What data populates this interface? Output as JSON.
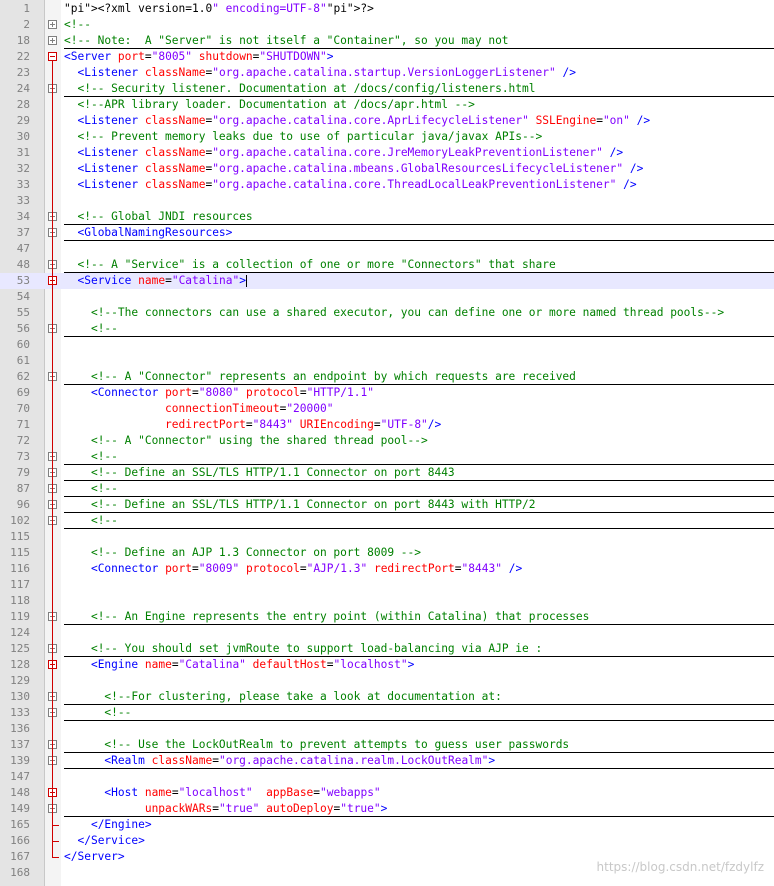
{
  "lines": [
    {
      "n": "1",
      "fold": "",
      "code": "<?xml version=\"1.0\" encoding=\"UTF-8\"?>",
      "under": false
    },
    {
      "n": "2",
      "fold": "closed",
      "code": "<!--",
      "under": false
    },
    {
      "n": "18",
      "fold": "closed",
      "code": "<!-- Note:  A \"Server\" is not itself a \"Container\", so you may not",
      "under": true
    },
    {
      "n": "22",
      "fold": "open",
      "code": "<Server port=\"8005\" shutdown=\"SHUTDOWN\">",
      "under": false
    },
    {
      "n": "23",
      "fold": "",
      "code": "  <Listener className=\"org.apache.catalina.startup.VersionLoggerListener\" />",
      "under": false
    },
    {
      "n": "24",
      "fold": "closed",
      "code": "  <!-- Security listener. Documentation at /docs/config/listeners.html",
      "under": true
    },
    {
      "n": "28",
      "fold": "",
      "code": "  <!--APR library loader. Documentation at /docs/apr.html -->",
      "under": false
    },
    {
      "n": "29",
      "fold": "",
      "code": "  <Listener className=\"org.apache.catalina.core.AprLifecycleListener\" SSLEngine=\"on\" />",
      "under": false
    },
    {
      "n": "30",
      "fold": "",
      "code": "  <!-- Prevent memory leaks due to use of particular java/javax APIs-->",
      "under": false
    },
    {
      "n": "31",
      "fold": "",
      "code": "  <Listener className=\"org.apache.catalina.core.JreMemoryLeakPreventionListener\" />",
      "under": false
    },
    {
      "n": "32",
      "fold": "",
      "code": "  <Listener className=\"org.apache.catalina.mbeans.GlobalResourcesLifecycleListener\" />",
      "under": false
    },
    {
      "n": "33",
      "fold": "",
      "code": "  <Listener className=\"org.apache.catalina.core.ThreadLocalLeakPreventionListener\" />",
      "under": false
    },
    {
      "n": "33",
      "fold": "",
      "code": "",
      "under": false
    },
    {
      "n": "34",
      "fold": "closed",
      "code": "  <!-- Global JNDI resources",
      "under": true
    },
    {
      "n": "37",
      "fold": "closed",
      "code": "  <GlobalNamingResources>",
      "under": true
    },
    {
      "n": "47",
      "fold": "",
      "code": "",
      "under": false
    },
    {
      "n": "48",
      "fold": "closed",
      "code": "  <!-- A \"Service\" is a collection of one or more \"Connectors\" that share",
      "under": true
    },
    {
      "n": "53",
      "fold": "open",
      "code": "  <Service name=\"Catalina\">",
      "under": false,
      "highlight": true
    },
    {
      "n": "54",
      "fold": "",
      "code": "",
      "under": false
    },
    {
      "n": "55",
      "fold": "",
      "code": "    <!--The connectors can use a shared executor, you can define one or more named thread pools-->",
      "under": false
    },
    {
      "n": "56",
      "fold": "closed",
      "code": "    <!--",
      "under": true
    },
    {
      "n": "60",
      "fold": "",
      "code": "",
      "under": false
    },
    {
      "n": "61",
      "fold": "",
      "code": "",
      "under": false
    },
    {
      "n": "62",
      "fold": "closed",
      "code": "    <!-- A \"Connector\" represents an endpoint by which requests are received",
      "under": true
    },
    {
      "n": "69",
      "fold": "",
      "code": "    <Connector port=\"8080\" protocol=\"HTTP/1.1\"",
      "under": false
    },
    {
      "n": "70",
      "fold": "",
      "code": "               connectionTimeout=\"20000\"",
      "under": false
    },
    {
      "n": "71",
      "fold": "",
      "code": "               redirectPort=\"8443\" URIEncoding=\"UTF-8\"/>",
      "under": false
    },
    {
      "n": "72",
      "fold": "",
      "code": "    <!-- A \"Connector\" using the shared thread pool-->",
      "under": false
    },
    {
      "n": "73",
      "fold": "closed",
      "code": "    <!--",
      "under": true
    },
    {
      "n": "79",
      "fold": "closed",
      "code": "    <!-- Define an SSL/TLS HTTP/1.1 Connector on port 8443",
      "under": true
    },
    {
      "n": "87",
      "fold": "closed",
      "code": "    <!--",
      "under": true
    },
    {
      "n": "96",
      "fold": "closed",
      "code": "    <!-- Define an SSL/TLS HTTP/1.1 Connector on port 8443 with HTTP/2",
      "under": true
    },
    {
      "n": "102",
      "fold": "closed",
      "code": "    <!--",
      "under": true
    },
    {
      "n": "115",
      "fold": "",
      "code": "",
      "under": false
    },
    {
      "n": "115",
      "fold": "",
      "code": "    <!-- Define an AJP 1.3 Connector on port 8009 -->",
      "under": false
    },
    {
      "n": "116",
      "fold": "",
      "code": "    <Connector port=\"8009\" protocol=\"AJP/1.3\" redirectPort=\"8443\" />",
      "under": false
    },
    {
      "n": "117",
      "fold": "",
      "code": "",
      "under": false
    },
    {
      "n": "118",
      "fold": "",
      "code": "",
      "under": false
    },
    {
      "n": "119",
      "fold": "closed",
      "code": "    <!-- An Engine represents the entry point (within Catalina) that processes",
      "under": true
    },
    {
      "n": "124",
      "fold": "",
      "code": "",
      "under": false
    },
    {
      "n": "125",
      "fold": "closed",
      "code": "    <!-- You should set jvmRoute to support load-balancing via AJP ie :",
      "under": true
    },
    {
      "n": "128",
      "fold": "open",
      "code": "    <Engine name=\"Catalina\" defaultHost=\"localhost\">",
      "under": false
    },
    {
      "n": "129",
      "fold": "",
      "code": "",
      "under": false
    },
    {
      "n": "130",
      "fold": "closed",
      "code": "      <!--For clustering, please take a look at documentation at:",
      "under": true
    },
    {
      "n": "133",
      "fold": "closed",
      "code": "      <!--",
      "under": true
    },
    {
      "n": "136",
      "fold": "",
      "code": "",
      "under": false
    },
    {
      "n": "137",
      "fold": "closed",
      "code": "      <!-- Use the LockOutRealm to prevent attempts to guess user passwords",
      "under": true
    },
    {
      "n": "139",
      "fold": "closed",
      "code": "      <Realm className=\"org.apache.catalina.realm.LockOutRealm\">",
      "under": true
    },
    {
      "n": "147",
      "fold": "",
      "code": "",
      "under": false
    },
    {
      "n": "148",
      "fold": "open",
      "code": "      <Host name=\"localhost\"  appBase=\"webapps\"",
      "under": false
    },
    {
      "n": "149",
      "fold": "closed",
      "code": "            unpackWARs=\"true\" autoDeploy=\"true\">",
      "under": true
    },
    {
      "n": "165",
      "fold": "end",
      "code": "    </Engine>",
      "under": false
    },
    {
      "n": "166",
      "fold": "end",
      "code": "  </Service>",
      "under": false
    },
    {
      "n": "167",
      "fold": "end",
      "code": "</Server>",
      "under": false
    },
    {
      "n": "168",
      "fold": "",
      "code": "",
      "under": false
    }
  ],
  "watermark": "https://blog.csdn.net/fzdylfz",
  "colors": {
    "comment": "#008000",
    "tag": "#0000ff",
    "attr": "#ff0000",
    "value": "#8000ff",
    "fold": "#d00000"
  }
}
